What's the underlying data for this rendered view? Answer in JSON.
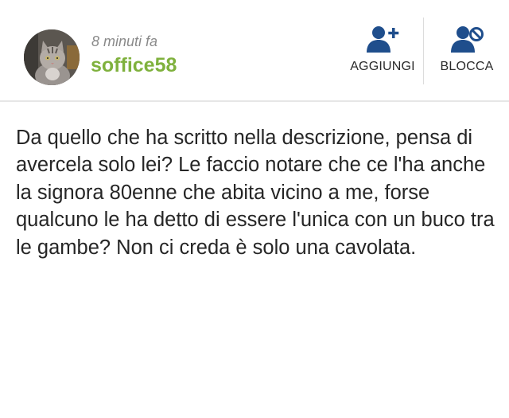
{
  "post": {
    "time": "8 minuti fa",
    "username": "soffice58",
    "avatar_icon": "cat-avatar",
    "message": "Da quello che ha scritto nella descrizione, pensa di avercela solo lei? Le faccio notare che ce l'ha anche la signora 80enne che abita vicino a me, forse qualcuno le ha detto di essere l'unica con un buco tra le gambe? Non ci creda è solo una cavolata."
  },
  "actions": {
    "add_label": "AGGIUNGI",
    "add_icon": "add-user-icon",
    "block_label": "BLOCCA",
    "block_icon": "block-user-icon"
  },
  "colors": {
    "username": "#7fb13d",
    "icon": "#1f4e8c",
    "time": "#8a8a8a",
    "text": "#262626"
  }
}
